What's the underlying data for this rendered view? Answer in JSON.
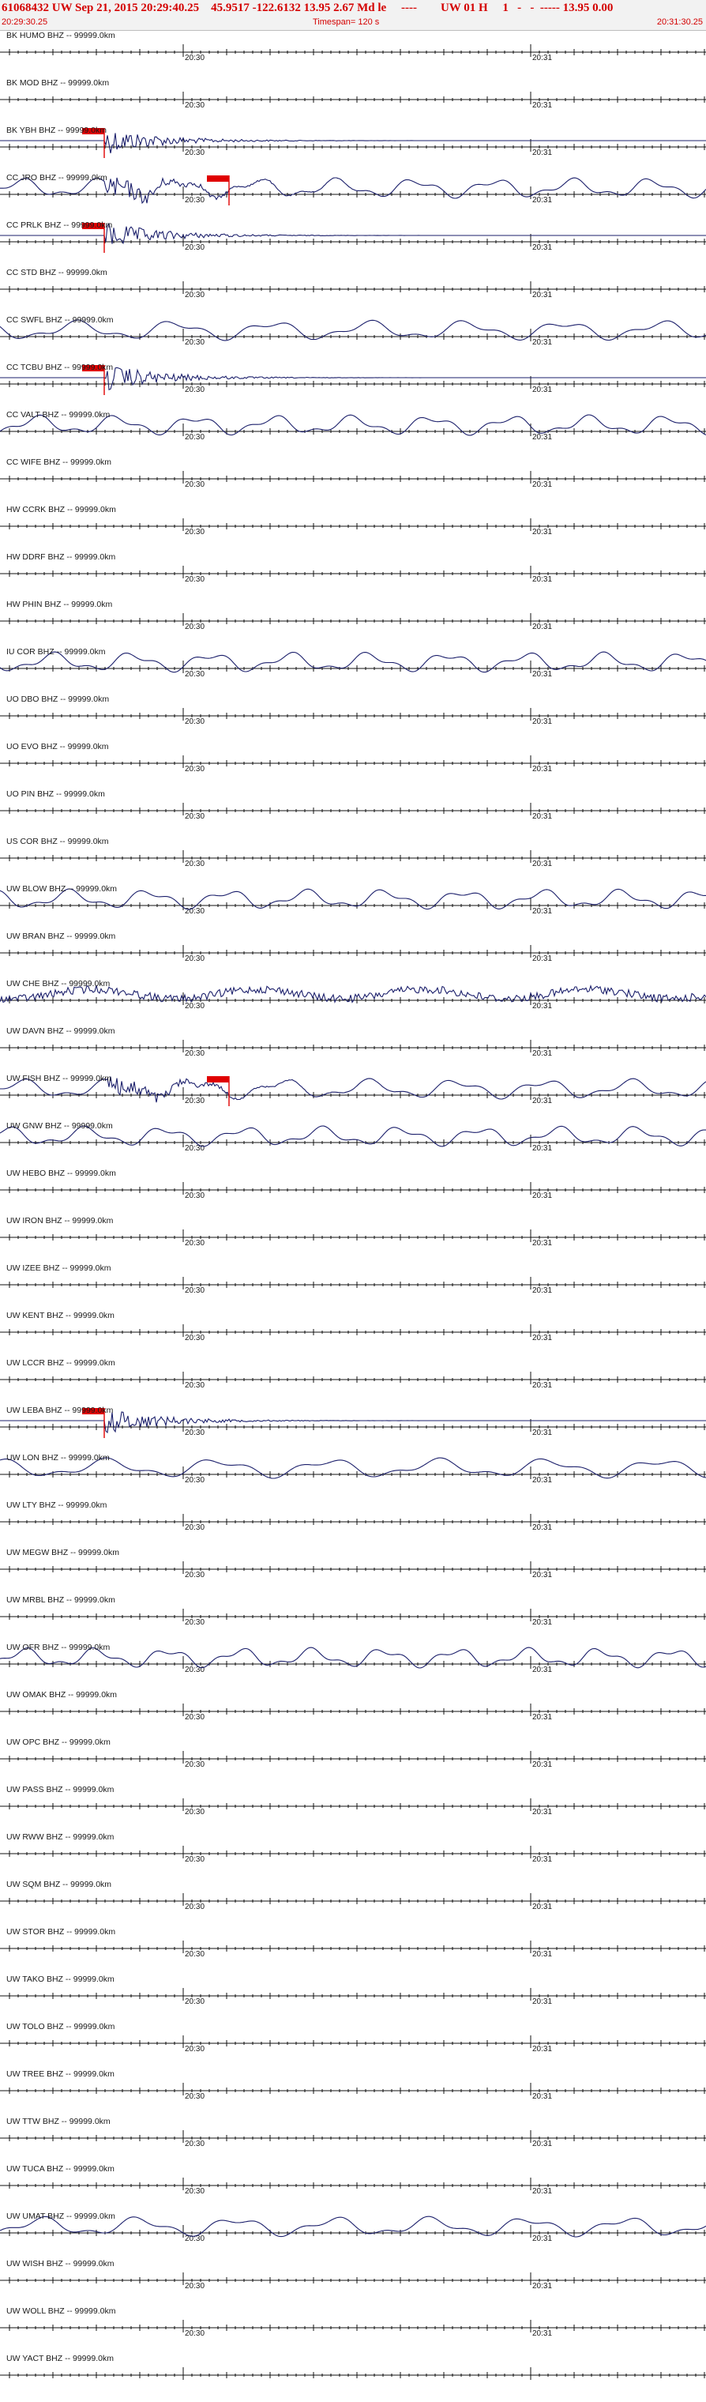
{
  "header": {
    "title": "61068432 UW Sep 21, 2015 20:29:40.25    45.9517 -122.6132 13.95 2.67 Md le     ----        UW 01 H     1   -   -  ----- 13.95 0.00",
    "start_time": "20:29:30.25",
    "timespan": "Timespan= 120 s",
    "end_time": "20:31:30.25"
  },
  "colors": {
    "header_text": "#d40000",
    "trace": "#1b1f6b",
    "pick": "#e00000",
    "header_bg": "#f2f2f2"
  },
  "chart_data": {
    "type": "line",
    "title": "61068432 UW Sep 21, 2015 20:29:40.25",
    "x_range": [
      "20:29:30.25",
      "20:31:30.25"
    ],
    "timespan_s": 120,
    "tick_labels": [
      "20:30",
      "20:31"
    ],
    "series": [
      {
        "name": "BK HUMO BHZ -- 99999.0km",
        "tick_label_a": "20:30",
        "tick_label_b": "20:31",
        "signal": "flat"
      },
      {
        "name": "BK MOD BHZ -- 99999.0km",
        "tick_label_a": "20:30",
        "tick_label_b": "20:31",
        "signal": "flat"
      },
      {
        "name": "BK YBH BHZ -- 99999.0km",
        "tick_label_a": "20:30",
        "tick_label_b": "20:31",
        "signal": "event"
      },
      {
        "name": "CC JRO BHZ -- 99999.0km",
        "tick_label_a": "20:30",
        "tick_label_b": "20:31",
        "signal": "event-wave"
      },
      {
        "name": "CC PRLK BHZ -- 99999.0km",
        "tick_label_a": "20:30",
        "tick_label_b": "20:31",
        "signal": "event"
      },
      {
        "name": "CC STD BHZ -- 99999.0km",
        "tick_label_a": "20:30",
        "tick_label_b": "20:31",
        "signal": "flat"
      },
      {
        "name": "CC SWFL BHZ -- 99999.0km",
        "tick_label_a": "20:30",
        "tick_label_b": "20:31",
        "signal": "wave"
      },
      {
        "name": "CC TCBU BHZ -- 99999.0km",
        "tick_label_a": "20:30",
        "tick_label_b": "20:31",
        "signal": "event"
      },
      {
        "name": "CC VALT BHZ -- 99999.0km",
        "tick_label_a": "20:30",
        "tick_label_b": "20:31",
        "signal": "wave"
      },
      {
        "name": "CC WIFE BHZ -- 99999.0km",
        "tick_label_a": "20:30",
        "tick_label_b": "20:31",
        "signal": "flat"
      },
      {
        "name": "HW CCRK BHZ -- 99999.0km",
        "tick_label_a": "20:30",
        "tick_label_b": "20:31",
        "signal": "flat"
      },
      {
        "name": "HW DDRF BHZ -- 99999.0km",
        "tick_label_a": "20:30",
        "tick_label_b": "20:31",
        "signal": "flat"
      },
      {
        "name": "HW PHIN BHZ -- 99999.0km",
        "tick_label_a": "20:30",
        "tick_label_b": "20:31",
        "signal": "flat"
      },
      {
        "name": "IU COR BHZ -- 99999.0km",
        "tick_label_a": "20:30",
        "tick_label_b": "20:31",
        "signal": "wave"
      },
      {
        "name": "UO DBO BHZ -- 99999.0km",
        "tick_label_a": "20:30",
        "tick_label_b": "20:31",
        "signal": "flat"
      },
      {
        "name": "UO EVO BHZ -- 99999.0km",
        "tick_label_a": "20:30",
        "tick_label_b": "20:31",
        "signal": "flat"
      },
      {
        "name": "UO PIN BHZ -- 99999.0km",
        "tick_label_a": "20:30",
        "tick_label_b": "20:31",
        "signal": "flat"
      },
      {
        "name": "US COR BHZ -- 99999.0km",
        "tick_label_a": "20:30",
        "tick_label_b": "20:31",
        "signal": "flat"
      },
      {
        "name": "UW BLOW BHZ -- 99999.0km",
        "tick_label_a": "20:30",
        "tick_label_b": "20:31",
        "signal": "wave"
      },
      {
        "name": "UW BRAN BHZ -- 99999.0km",
        "tick_label_a": "20:30",
        "tick_label_b": "20:31",
        "signal": "flat"
      },
      {
        "name": "UW CHE BHZ -- 99999.0km",
        "tick_label_a": "20:30",
        "tick_label_b": "20:31",
        "signal": "noise"
      },
      {
        "name": "UW DAVN BHZ -- 99999.0km",
        "tick_label_a": "20:30",
        "tick_label_b": "20:31",
        "signal": "flat"
      },
      {
        "name": "UW FISH BHZ -- 99999.0km",
        "tick_label_a": "20:30",
        "tick_label_b": "20:31",
        "signal": "event-wave"
      },
      {
        "name": "UW GNW BHZ -- 99999.0km",
        "tick_label_a": "20:30",
        "tick_label_b": "20:31",
        "signal": "wave"
      },
      {
        "name": "UW HEBO BHZ -- 99999.0km",
        "tick_label_a": "20:30",
        "tick_label_b": "20:31",
        "signal": "flat"
      },
      {
        "name": "UW IRON BHZ -- 99999.0km",
        "tick_label_a": "20:30",
        "tick_label_b": "20:31",
        "signal": "flat"
      },
      {
        "name": "UW IZEE BHZ -- 99999.0km",
        "tick_label_a": "20:30",
        "tick_label_b": "20:31",
        "signal": "flat"
      },
      {
        "name": "UW KENT BHZ -- 99999.0km",
        "tick_label_a": "20:30",
        "tick_label_b": "20:31",
        "signal": "flat"
      },
      {
        "name": "UW LCCR BHZ -- 99999.0km",
        "tick_label_a": "20:30",
        "tick_label_b": "20:31",
        "signal": "flat"
      },
      {
        "name": "UW LEBA BHZ -- 99999.0km",
        "tick_label_a": "20:30",
        "tick_label_b": "20:31",
        "signal": "event"
      },
      {
        "name": "UW LON BHZ -- 99999.0km",
        "tick_label_a": "20:30",
        "tick_label_b": "20:31",
        "signal": "wave"
      },
      {
        "name": "UW LTY BHZ -- 99999.0km",
        "tick_label_a": "20:30",
        "tick_label_b": "20:31",
        "signal": "flat"
      },
      {
        "name": "UW MEGW BHZ -- 99999.0km",
        "tick_label_a": "20:30",
        "tick_label_b": "20:31",
        "signal": "flat"
      },
      {
        "name": "UW MRBL BHZ -- 99999.0km",
        "tick_label_a": "20:30",
        "tick_label_b": "20:31",
        "signal": "flat"
      },
      {
        "name": "UW OFR BHZ -- 99999.0km",
        "tick_label_a": "20:30",
        "tick_label_b": "20:31",
        "signal": "wave"
      },
      {
        "name": "UW OMAK BHZ -- 99999.0km",
        "tick_label_a": "20:30",
        "tick_label_b": "20:31",
        "signal": "flat"
      },
      {
        "name": "UW OPC BHZ -- 99999.0km",
        "tick_label_a": "20:30",
        "tick_label_b": "20:31",
        "signal": "flat"
      },
      {
        "name": "UW PASS BHZ -- 99999.0km",
        "tick_label_a": "20:30",
        "tick_label_b": "20:31",
        "signal": "flat"
      },
      {
        "name": "UW RWW BHZ -- 99999.0km",
        "tick_label_a": "20:30",
        "tick_label_b": "20:31",
        "signal": "flat"
      },
      {
        "name": "UW SQM BHZ -- 99999.0km",
        "tick_label_a": "20:30",
        "tick_label_b": "20:31",
        "signal": "flat"
      },
      {
        "name": "UW STOR BHZ -- 99999.0km",
        "tick_label_a": "20:30",
        "tick_label_b": "20:31",
        "signal": "flat"
      },
      {
        "name": "UW TAKO BHZ -- 99999.0km",
        "tick_label_a": "20:30",
        "tick_label_b": "20:31",
        "signal": "flat"
      },
      {
        "name": "UW TOLO BHZ -- 99999.0km",
        "tick_label_a": "20:30",
        "tick_label_b": "20:31",
        "signal": "flat"
      },
      {
        "name": "UW TREE BHZ -- 99999.0km",
        "tick_label_a": "20:30",
        "tick_label_b": "20:31",
        "signal": "flat"
      },
      {
        "name": "UW TTW BHZ -- 99999.0km",
        "tick_label_a": "20:30",
        "tick_label_b": "20:31",
        "signal": "flat"
      },
      {
        "name": "UW TUCA BHZ -- 99999.0km",
        "tick_label_a": "20:30",
        "tick_label_b": "20:31",
        "signal": "flat"
      },
      {
        "name": "UW UMAT BHZ -- 99999.0km",
        "tick_label_a": "20:30",
        "tick_label_b": "20:31",
        "signal": "wave"
      },
      {
        "name": "UW WISH BHZ -- 99999.0km",
        "tick_label_a": "20:30",
        "tick_label_b": "20:31",
        "signal": "flat"
      },
      {
        "name": "UW WOLL BHZ -- 99999.0km",
        "tick_label_a": "20:30",
        "tick_label_b": "20:31",
        "signal": "flat"
      },
      {
        "name": "UW YACT BHZ -- 99999.0km",
        "tick_label_a": "",
        "tick_label_b": "",
        "signal": "flat"
      }
    ]
  }
}
